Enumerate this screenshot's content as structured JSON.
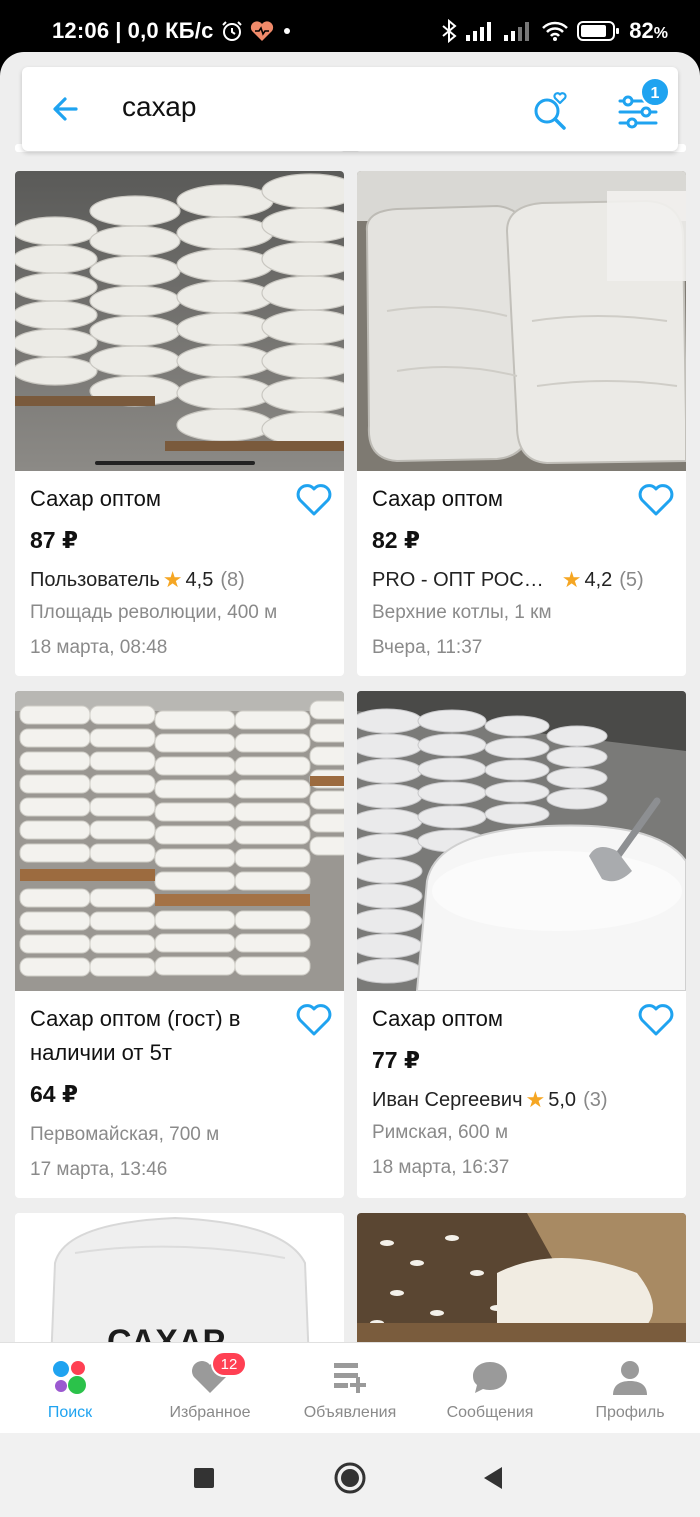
{
  "status_bar": {
    "time": "12:06",
    "speed": "0,0 КБ/с",
    "battery": "82"
  },
  "search": {
    "query": "сахар",
    "filter_badge": "1",
    "icons": [
      "back-arrow-icon",
      "saved-search-icon",
      "filter-icon"
    ]
  },
  "listings": [
    {
      "title": "Сахар оптом",
      "price": "87 ₽",
      "seller": "Пользователь",
      "rating": "4,5",
      "reviews": "(8)",
      "location": "Площадь революции, 400 м",
      "date": "18 марта, 08:48"
    },
    {
      "title": "Сахар оптом",
      "price": "82 ₽",
      "seller": "PRO - ОПТ РОС…",
      "rating": "4,2",
      "reviews": "(5)",
      "location": "Верхние котлы, 1 км",
      "date": "Вчера, 11:37"
    },
    {
      "title": "Сахар оптом (гост) в наличии от 5т",
      "price": "64 ₽",
      "location": "Первомайская, 700 м",
      "date": "17 марта, 13:46"
    },
    {
      "title": "Сахар оптом",
      "price": "77 ₽",
      "seller": "Иван Сергеевич",
      "rating": "5,0",
      "reviews": "(3)",
      "location": "Римская, 600 м",
      "date": "18 марта, 16:37"
    }
  ],
  "peek_listing_sign": "САХАР",
  "bottom_nav": {
    "items": [
      {
        "label": "Поиск",
        "icon": "search-dots-icon",
        "active": true
      },
      {
        "label": "Избранное",
        "icon": "heart-icon",
        "badge": "12"
      },
      {
        "label": "Объявления",
        "icon": "add-listing-icon"
      },
      {
        "label": "Сообщения",
        "icon": "chat-icon"
      },
      {
        "label": "Профиль",
        "icon": "profile-icon"
      }
    ]
  },
  "colors": {
    "accent": "#1fa3f0",
    "star": "#f5a623",
    "badge_red": "#ff4053"
  }
}
